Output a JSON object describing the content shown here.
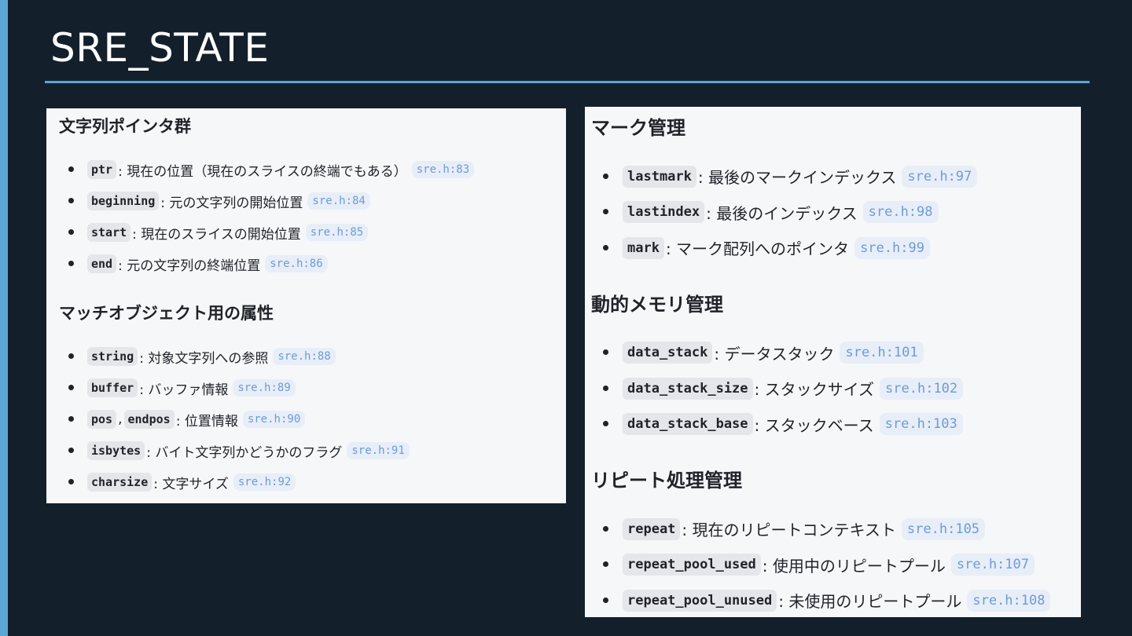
{
  "slide": {
    "title": "SRE_STATE"
  },
  "left_card": {
    "sections": [
      {
        "heading": "文字列ポインタ群",
        "items": [
          {
            "codes": [
              "ptr"
            ],
            "desc": ": 現在の位置（現在のスライスの終端でもある）",
            "ref": "sre.h:83"
          },
          {
            "codes": [
              "beginning"
            ],
            "desc": ": 元の文字列の開始位置",
            "ref": "sre.h:84"
          },
          {
            "codes": [
              "start"
            ],
            "desc": ": 現在のスライスの開始位置",
            "ref": "sre.h:85"
          },
          {
            "codes": [
              "end"
            ],
            "desc": ": 元の文字列の終端位置",
            "ref": "sre.h:86"
          }
        ]
      },
      {
        "heading": "マッチオブジェクト用の属性",
        "items": [
          {
            "codes": [
              "string"
            ],
            "desc": ": 対象文字列への参照",
            "ref": "sre.h:88"
          },
          {
            "codes": [
              "buffer"
            ],
            "desc": ": バッファ情報",
            "ref": "sre.h:89"
          },
          {
            "codes": [
              "pos",
              "endpos"
            ],
            "sep": ",",
            "desc": ": 位置情報",
            "ref": "sre.h:90"
          },
          {
            "codes": [
              "isbytes"
            ],
            "desc": ": バイト文字列かどうかのフラグ",
            "ref": "sre.h:91"
          },
          {
            "codes": [
              "charsize"
            ],
            "desc": ": 文字サイズ",
            "ref": "sre.h:92"
          }
        ]
      }
    ]
  },
  "right_card": {
    "sections": [
      {
        "heading": "マーク管理",
        "items": [
          {
            "codes": [
              "lastmark"
            ],
            "desc": ": 最後のマークインデックス",
            "ref": "sre.h:97"
          },
          {
            "codes": [
              "lastindex"
            ],
            "desc": ": 最後のインデックス",
            "ref": "sre.h:98"
          },
          {
            "codes": [
              "mark"
            ],
            "desc": ": マーク配列へのポインタ",
            "ref": "sre.h:99"
          }
        ]
      },
      {
        "heading": "動的メモリ管理",
        "items": [
          {
            "codes": [
              "data_stack"
            ],
            "desc": ": データスタック",
            "ref": "sre.h:101"
          },
          {
            "codes": [
              "data_stack_size"
            ],
            "desc": ": スタックサイズ",
            "ref": "sre.h:102"
          },
          {
            "codes": [
              "data_stack_base"
            ],
            "desc": ": スタックベース",
            "ref": "sre.h:103"
          }
        ]
      },
      {
        "heading": "リピート処理管理",
        "items": [
          {
            "codes": [
              "repeat"
            ],
            "desc": ": 現在のリピートコンテキスト",
            "ref": "sre.h:105"
          },
          {
            "codes": [
              "repeat_pool_used"
            ],
            "desc": ": 使用中のリピートプール",
            "ref": "sre.h:107"
          },
          {
            "codes": [
              "repeat_pool_unused"
            ],
            "desc": ": 未使用のリピートプール",
            "ref": "sre.h:108"
          }
        ]
      }
    ]
  }
}
